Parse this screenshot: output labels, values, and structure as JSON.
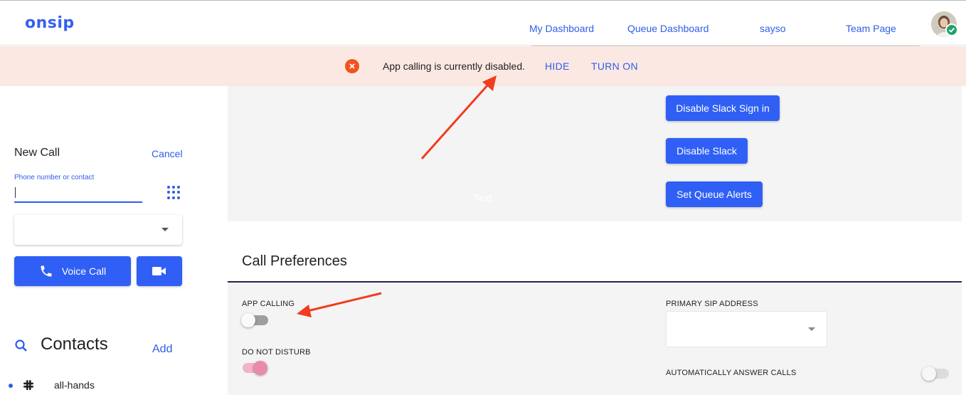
{
  "header": {
    "logo": "onsip",
    "nav": [
      "My Dashboard",
      "Queue Dashboard",
      "sayso",
      "Team Page"
    ]
  },
  "banner": {
    "message": "App calling is currently disabled.",
    "hide": "HIDE",
    "turn_on": "TURN ON",
    "icon": "error-circle-icon",
    "icon_color": "#f0541e",
    "bg_color": "#fbe8e2"
  },
  "sidebar": {
    "new_call": "New Call",
    "cancel": "Cancel",
    "phone_label": "Phone number or contact",
    "phone_value": "",
    "voice_call": "Voice Call",
    "contacts": "Contacts",
    "add": "Add",
    "contact_items": [
      {
        "name": "all-hands",
        "icon": "slack-icon"
      }
    ]
  },
  "actions": {
    "disable_slack_sign_in": "Disable Slack Sign in",
    "disable_slack": "Disable Slack",
    "set_queue_alerts": "Set Queue Alerts",
    "ghost_text": "Text"
  },
  "preferences": {
    "title": "Call Preferences",
    "app_calling": {
      "label": "APP CALLING",
      "on": false
    },
    "do_not_disturb": {
      "label": "DO NOT DISTURB",
      "on": true
    },
    "primary_sip": {
      "label": "PRIMARY SIP ADDRESS",
      "value": ""
    },
    "auto_answer": {
      "label": "AUTOMATICALLY ANSWER CALLS",
      "on": false
    }
  },
  "colors": {
    "accent": "#2f5ff5",
    "annotation_arrow": "#f03c1f",
    "dnd_toggle": "#e88aa8"
  }
}
